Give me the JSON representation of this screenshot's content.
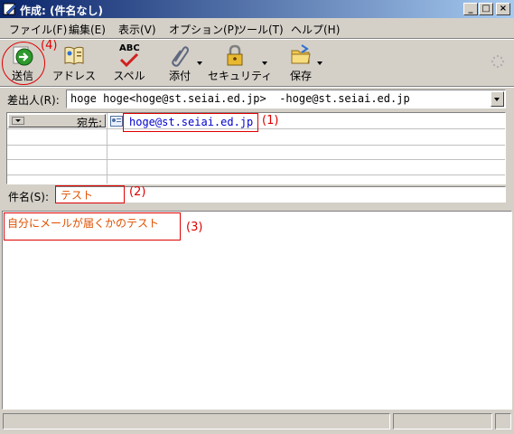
{
  "window": {
    "title": "作成: (件名なし)",
    "minimize": "_",
    "maximize": "□",
    "close": "×"
  },
  "menu": [
    "ファイル(F)",
    "編集(E)",
    "表示(V)",
    "オプション(P)",
    "ツール(T)",
    "ヘルプ(H)"
  ],
  "toolbar": {
    "send": "送信",
    "address": "アドレス",
    "spell": "スペル",
    "spell_icon_text": "ABC",
    "attach": "添付",
    "security": "セキュリティ",
    "save": "保存"
  },
  "from": {
    "label": "差出人(R):",
    "value": "hoge hoge<hoge@st.seiai.ed.jp>  -hoge@st.seiai.ed.jp"
  },
  "recipients": {
    "type_label": "宛先:",
    "address": "hoge@st.seiai.ed.jp"
  },
  "subject": {
    "label": "件名(S):",
    "value": "テスト"
  },
  "body": {
    "text": "自分にメールが届くかのテスト"
  },
  "annotations": {
    "a1": "(1)",
    "a2": "(2)",
    "a3": "(3)",
    "a4": "(4)",
    "color": "#e00000"
  }
}
